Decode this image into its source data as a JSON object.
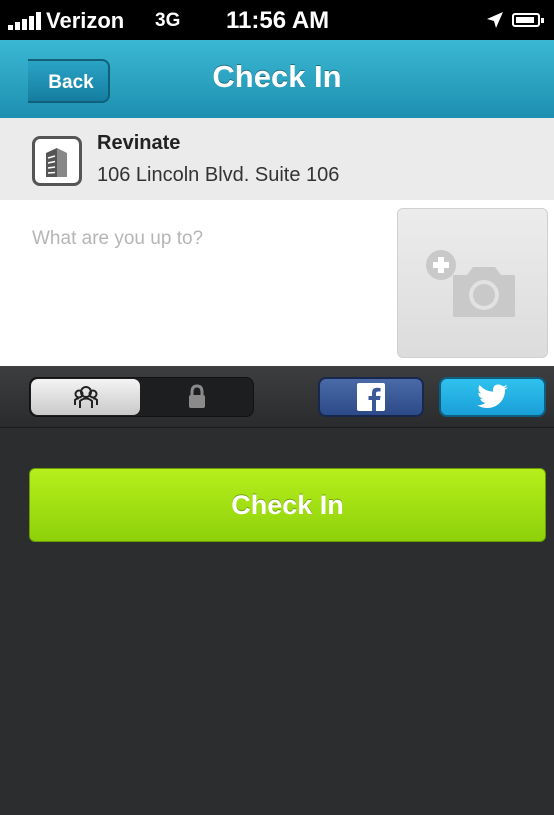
{
  "status_bar": {
    "carrier": "Verizon",
    "network": "3G",
    "time": "11:56 AM",
    "icons": [
      "signal-bars-icon",
      "location-arrow-icon",
      "battery-icon"
    ]
  },
  "nav": {
    "back_label": "Back",
    "title": "Check In"
  },
  "venue": {
    "icon": "building-icon",
    "name": "Revinate",
    "address": "106 Lincoln Blvd. Suite 106"
  },
  "compose": {
    "placeholder": "What are you up to?",
    "value": "",
    "photo_icon": "add-photo-camera-icon"
  },
  "share": {
    "privacy_options": [
      "people-icon",
      "lock-icon"
    ],
    "selected_privacy": "people-icon",
    "facebook_icon": "facebook-icon",
    "twitter_icon": "twitter-icon"
  },
  "action": {
    "checkin_label": "Check In"
  },
  "colors": {
    "nav_blue": "#2aa3c5",
    "checkin_green": "#a6e413",
    "facebook_blue": "#3b5998",
    "twitter_blue": "#27b5e8",
    "panel_dark": "#2c2d2f"
  }
}
